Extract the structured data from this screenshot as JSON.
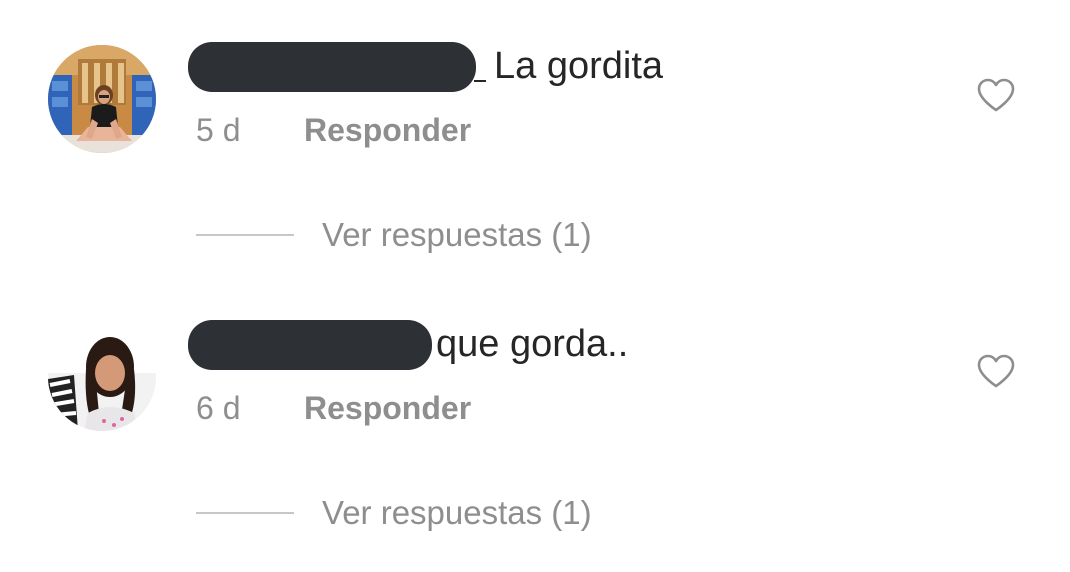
{
  "comments": [
    {
      "username": "",
      "text": "La gordita",
      "time": "5 d",
      "reply_label": "Responder",
      "view_replies_label": "Ver respuestas (1)",
      "liked": false
    },
    {
      "username": "",
      "text": "que gorda..",
      "time": "6 d",
      "reply_label": "Responder",
      "view_replies_label": "Ver respuestas (1)",
      "liked": false
    }
  ],
  "colors": {
    "text_primary": "#262626",
    "text_secondary": "#8e8e8e",
    "divider": "#c7c7c7",
    "redaction": "#2d3136"
  },
  "icons": {
    "like": "heart-outline-icon"
  }
}
